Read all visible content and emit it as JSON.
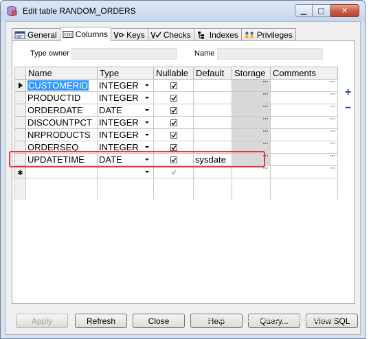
{
  "window": {
    "title": "Edit table RANDOM_ORDERS",
    "minimize": "▁",
    "maximize": "▢",
    "close": "✕"
  },
  "tabs": [
    {
      "label": "General",
      "icon": "general-icon"
    },
    {
      "label": "Columns",
      "icon": "columns-icon",
      "active": true
    },
    {
      "label": "Keys",
      "icon": "keys-icon"
    },
    {
      "label": "Checks",
      "icon": "checks-icon"
    },
    {
      "label": "Indexes",
      "icon": "indexes-icon"
    },
    {
      "label": "Privileges",
      "icon": "privileges-icon"
    }
  ],
  "form": {
    "type_owner_label": "Type owner",
    "type_owner_value": "",
    "name_label": "Name",
    "name_value": ""
  },
  "grid": {
    "headers": [
      "Name",
      "Type",
      "Nullable",
      "Default",
      "Storage",
      "Comments"
    ],
    "rows": [
      {
        "name": "CUSTOMERID",
        "type": "INTEGER",
        "nullable": true,
        "default": "",
        "comments": "",
        "current": true,
        "selected": true
      },
      {
        "name": "PRODUCTID",
        "type": "INTEGER",
        "nullable": true,
        "default": "",
        "comments": ""
      },
      {
        "name": "ORDERDATE",
        "type": "DATE",
        "nullable": true,
        "default": "",
        "comments": ""
      },
      {
        "name": "DISCOUNTPCT",
        "type": "INTEGER",
        "nullable": true,
        "default": "",
        "comments": ""
      },
      {
        "name": "NRPRODUCTS",
        "type": "INTEGER",
        "nullable": true,
        "default": "",
        "comments": ""
      },
      {
        "name": "ORDERSEQ",
        "type": "INTEGER",
        "nullable": true,
        "default": "",
        "comments": ""
      },
      {
        "name": "UPDATETIME",
        "type": "DATE",
        "nullable": true,
        "default": "sysdate",
        "comments": ""
      }
    ],
    "new_row_marker": "✱",
    "ellipsis": "···"
  },
  "side": {
    "add": "+",
    "remove": "−"
  },
  "buttons": {
    "apply": "Apply",
    "refresh": "Refresh",
    "close": "Close",
    "help": "Help",
    "query": "Query...",
    "view_sql": "View SQL"
  },
  "watermark": "https://blog.csdn.net/zhangbest2009",
  "colors": {
    "selection": "#3399ff",
    "highlight": "#e53a3a",
    "accent": "#1a3fa8"
  }
}
